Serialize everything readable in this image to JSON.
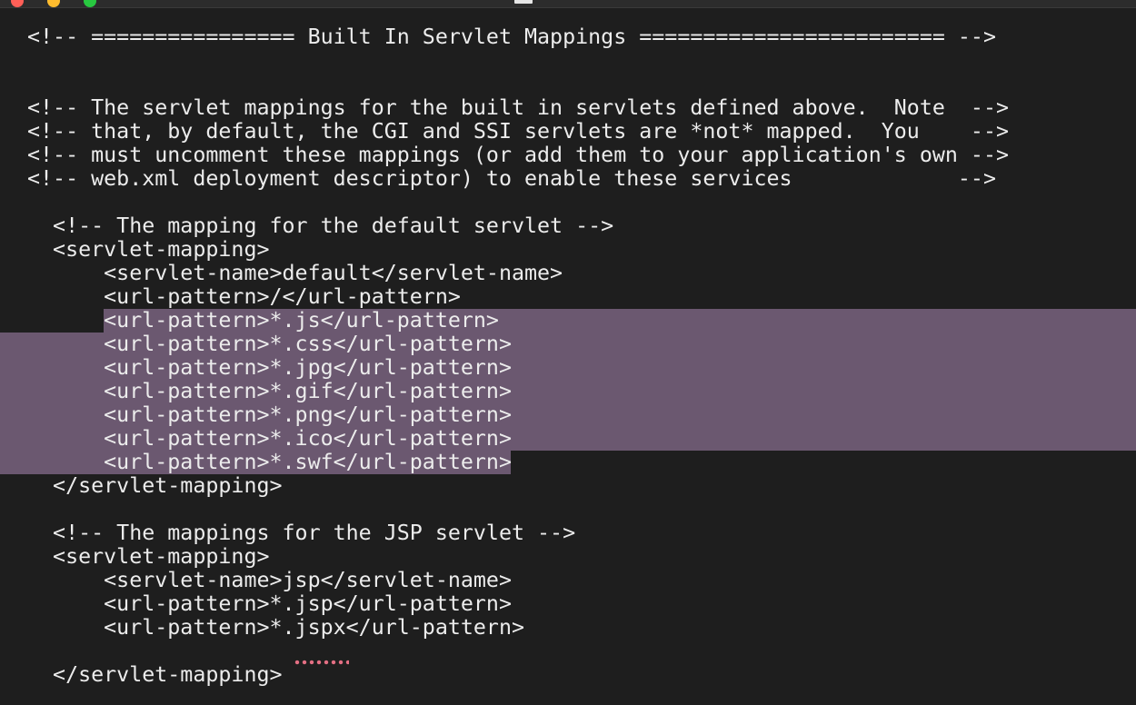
{
  "editor": {
    "lines": [
      "<!-- ================ Built In Servlet Mappings ======================== -->",
      "",
      "",
      "<!-- The servlet mappings for the built in servlets defined above.  Note  -->",
      "<!-- that, by default, the CGI and SSI servlets are *not* mapped.  You    -->",
      "<!-- must uncomment these mappings (or add them to your application's own -->",
      "<!-- web.xml deployment descriptor) to enable these services             -->",
      "",
      "  <!-- The mapping for the default servlet -->",
      "  <servlet-mapping>",
      "      <servlet-name>default</servlet-name>",
      "      <url-pattern>/</url-pattern>",
      "      <url-pattern>*.js</url-pattern>",
      "      <url-pattern>*.css</url-pattern>",
      "      <url-pattern>*.jpg</url-pattern>",
      "      <url-pattern>*.gif</url-pattern>",
      "      <url-pattern>*.png</url-pattern>",
      "      <url-pattern>*.ico</url-pattern>",
      "      <url-pattern>*.swf</url-pattern>",
      "  </servlet-mapping>",
      "",
      "  <!-- The mappings for the JSP servlet -->",
      "  <servlet-mapping>",
      "      <servlet-name>jsp</servlet-name>",
      "      <url-pattern>*.jsp</url-pattern>",
      "      <url-pattern>*.jspx</url-pattern>",
      "",
      "  </servlet-mapping>"
    ]
  },
  "colors": {
    "background": "#1e1e1e",
    "text": "#ececec",
    "selection": "#6b5870",
    "spellcheck_underline": "#e36f83"
  }
}
